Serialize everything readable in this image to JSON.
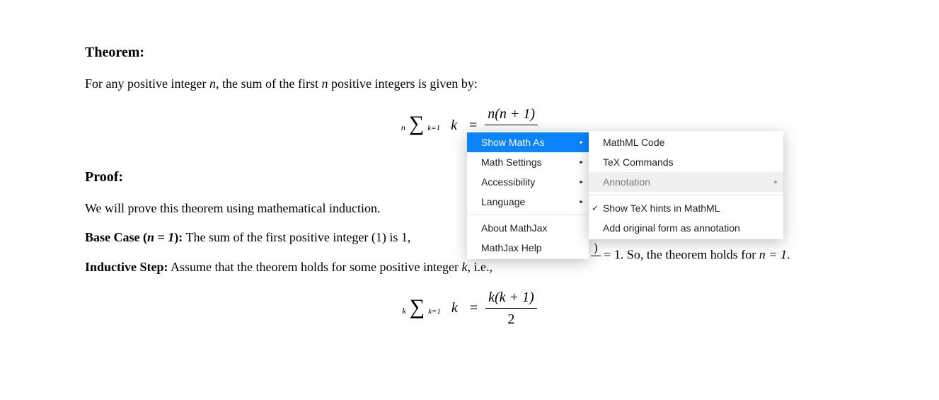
{
  "doc": {
    "theorem_heading": "Theorem:",
    "theorem_text_pre": "For any positive integer ",
    "theorem_text_mid": ", the sum of the first ",
    "theorem_text_post": " positive integers is given by:",
    "var_n": "n",
    "formula1": {
      "sum_top": "n",
      "sum_bottom": "k=1",
      "sum_var": "k",
      "eq": "=",
      "frac_num": "n(n + 1)"
    },
    "proof_heading": "Proof:",
    "proof_intro": "We will prove this theorem using mathematical induction.",
    "base_label": "Base Case (",
    "base_eq": "n = 1",
    "base_label_close": "):",
    "base_text1": " The sum of the first positive integer (1) is 1, ",
    "tail_frag": ")",
    "tail_eq": " = 1. So, the theorem holds for ",
    "tail_var": "n = 1",
    "tail_dot": ".",
    "inductive_label": "Inductive Step:",
    "inductive_text_pre": " Assume that the theorem holds for some positive integer ",
    "inductive_var": "k",
    "inductive_text_post": ", i.e.,",
    "formula2": {
      "sum_top": "k",
      "sum_bottom": "k=1",
      "sum_var": "k",
      "eq": "=",
      "frac_num": "k(k + 1)",
      "frac_den": "2"
    }
  },
  "menu": {
    "show_math_as": "Show Math As",
    "math_settings": "Math Settings",
    "accessibility": "Accessibility",
    "language": "Language",
    "about": "About MathJax",
    "help": "MathJax Help",
    "sub": {
      "mathml": "MathML Code",
      "tex": "TeX Commands",
      "annotation": "Annotation",
      "show_tex_hints": "Show TeX hints in MathML",
      "add_original": "Add original form as annotation"
    }
  }
}
